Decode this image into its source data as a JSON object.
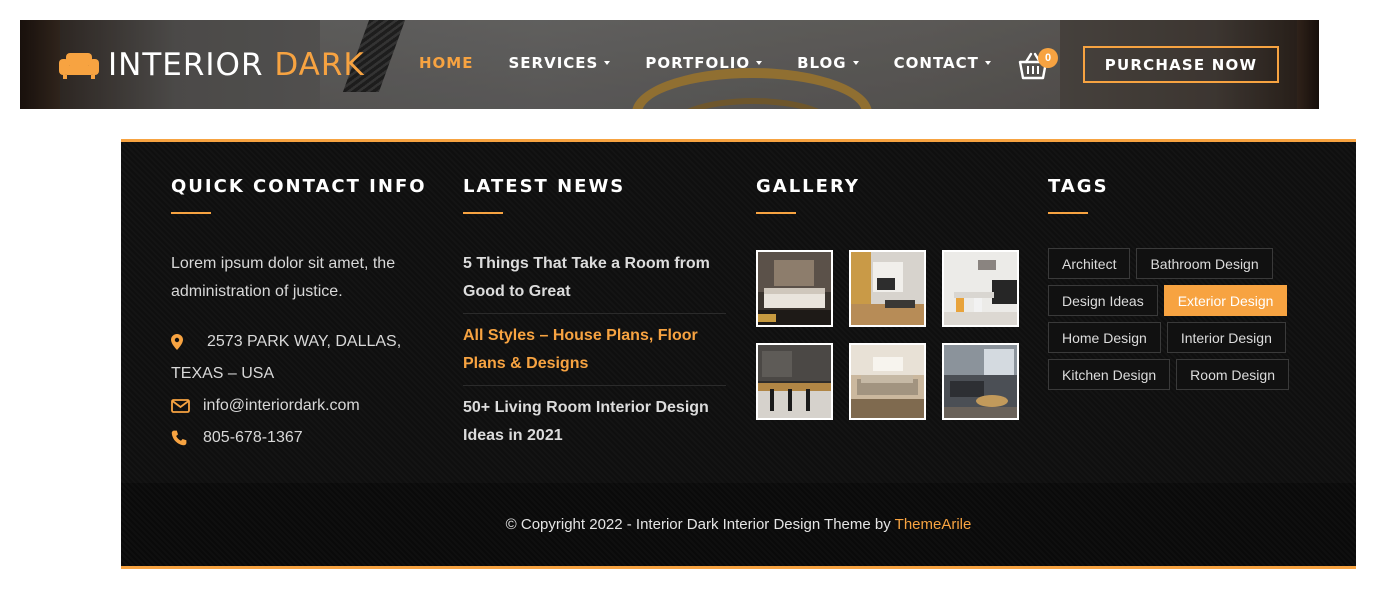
{
  "header": {
    "logo_main": "INTERIOR",
    "logo_accent": "DARK",
    "nav": [
      {
        "label": "HOME",
        "active": true,
        "dropdown": false
      },
      {
        "label": "SERVICES",
        "active": false,
        "dropdown": true
      },
      {
        "label": "PORTFOLIO",
        "active": false,
        "dropdown": true
      },
      {
        "label": "BLOG",
        "active": false,
        "dropdown": true
      },
      {
        "label": "CONTACT",
        "active": false,
        "dropdown": true
      }
    ],
    "cart_count": "0",
    "purchase_label": "PURCHASE NOW",
    "accent_color": "#f7a341"
  },
  "footer": {
    "contact": {
      "title": "QUICK CONTACT INFO",
      "about": "Lorem ipsum dolor sit amet, the administration of justice.",
      "address_line1": "2573 PARK WAY, DALLAS,",
      "address_line2": "TEXAS – USA",
      "email": "info@interiordark.com",
      "phone": "805-678-1367",
      "icons": [
        "map-pin-icon",
        "envelope-icon",
        "phone-icon"
      ]
    },
    "news": {
      "title": "LATEST NEWS",
      "items": [
        {
          "title": "5 Things That Take a Room from Good to Great",
          "highlight": false
        },
        {
          "title": "All Styles – House Plans, Floor Plans & Designs",
          "highlight": true
        },
        {
          "title": "50+ Living Room Interior Design Ideas in 2021",
          "highlight": false
        }
      ]
    },
    "gallery": {
      "title": "GALLERY",
      "images": [
        "bedroom-photo",
        "living-room-photo",
        "dining-room-photo",
        "kitchen-photo",
        "lounge-photo",
        "sitting-area-photo"
      ]
    },
    "tags": {
      "title": "TAGS",
      "items": [
        {
          "label": "Architect",
          "active": false
        },
        {
          "label": "Bathroom Design",
          "active": false
        },
        {
          "label": "Design Ideas",
          "active": false
        },
        {
          "label": "Exterior Design",
          "active": true
        },
        {
          "label": "Home Design",
          "active": false
        },
        {
          "label": "Interior Design",
          "active": false
        },
        {
          "label": "Kitchen Design",
          "active": false
        },
        {
          "label": "Room Design",
          "active": false
        }
      ]
    },
    "copyright_text": "© Copyright 2022 - Interior Dark Interior Design Theme by ",
    "copyright_link": "ThemeArile"
  }
}
